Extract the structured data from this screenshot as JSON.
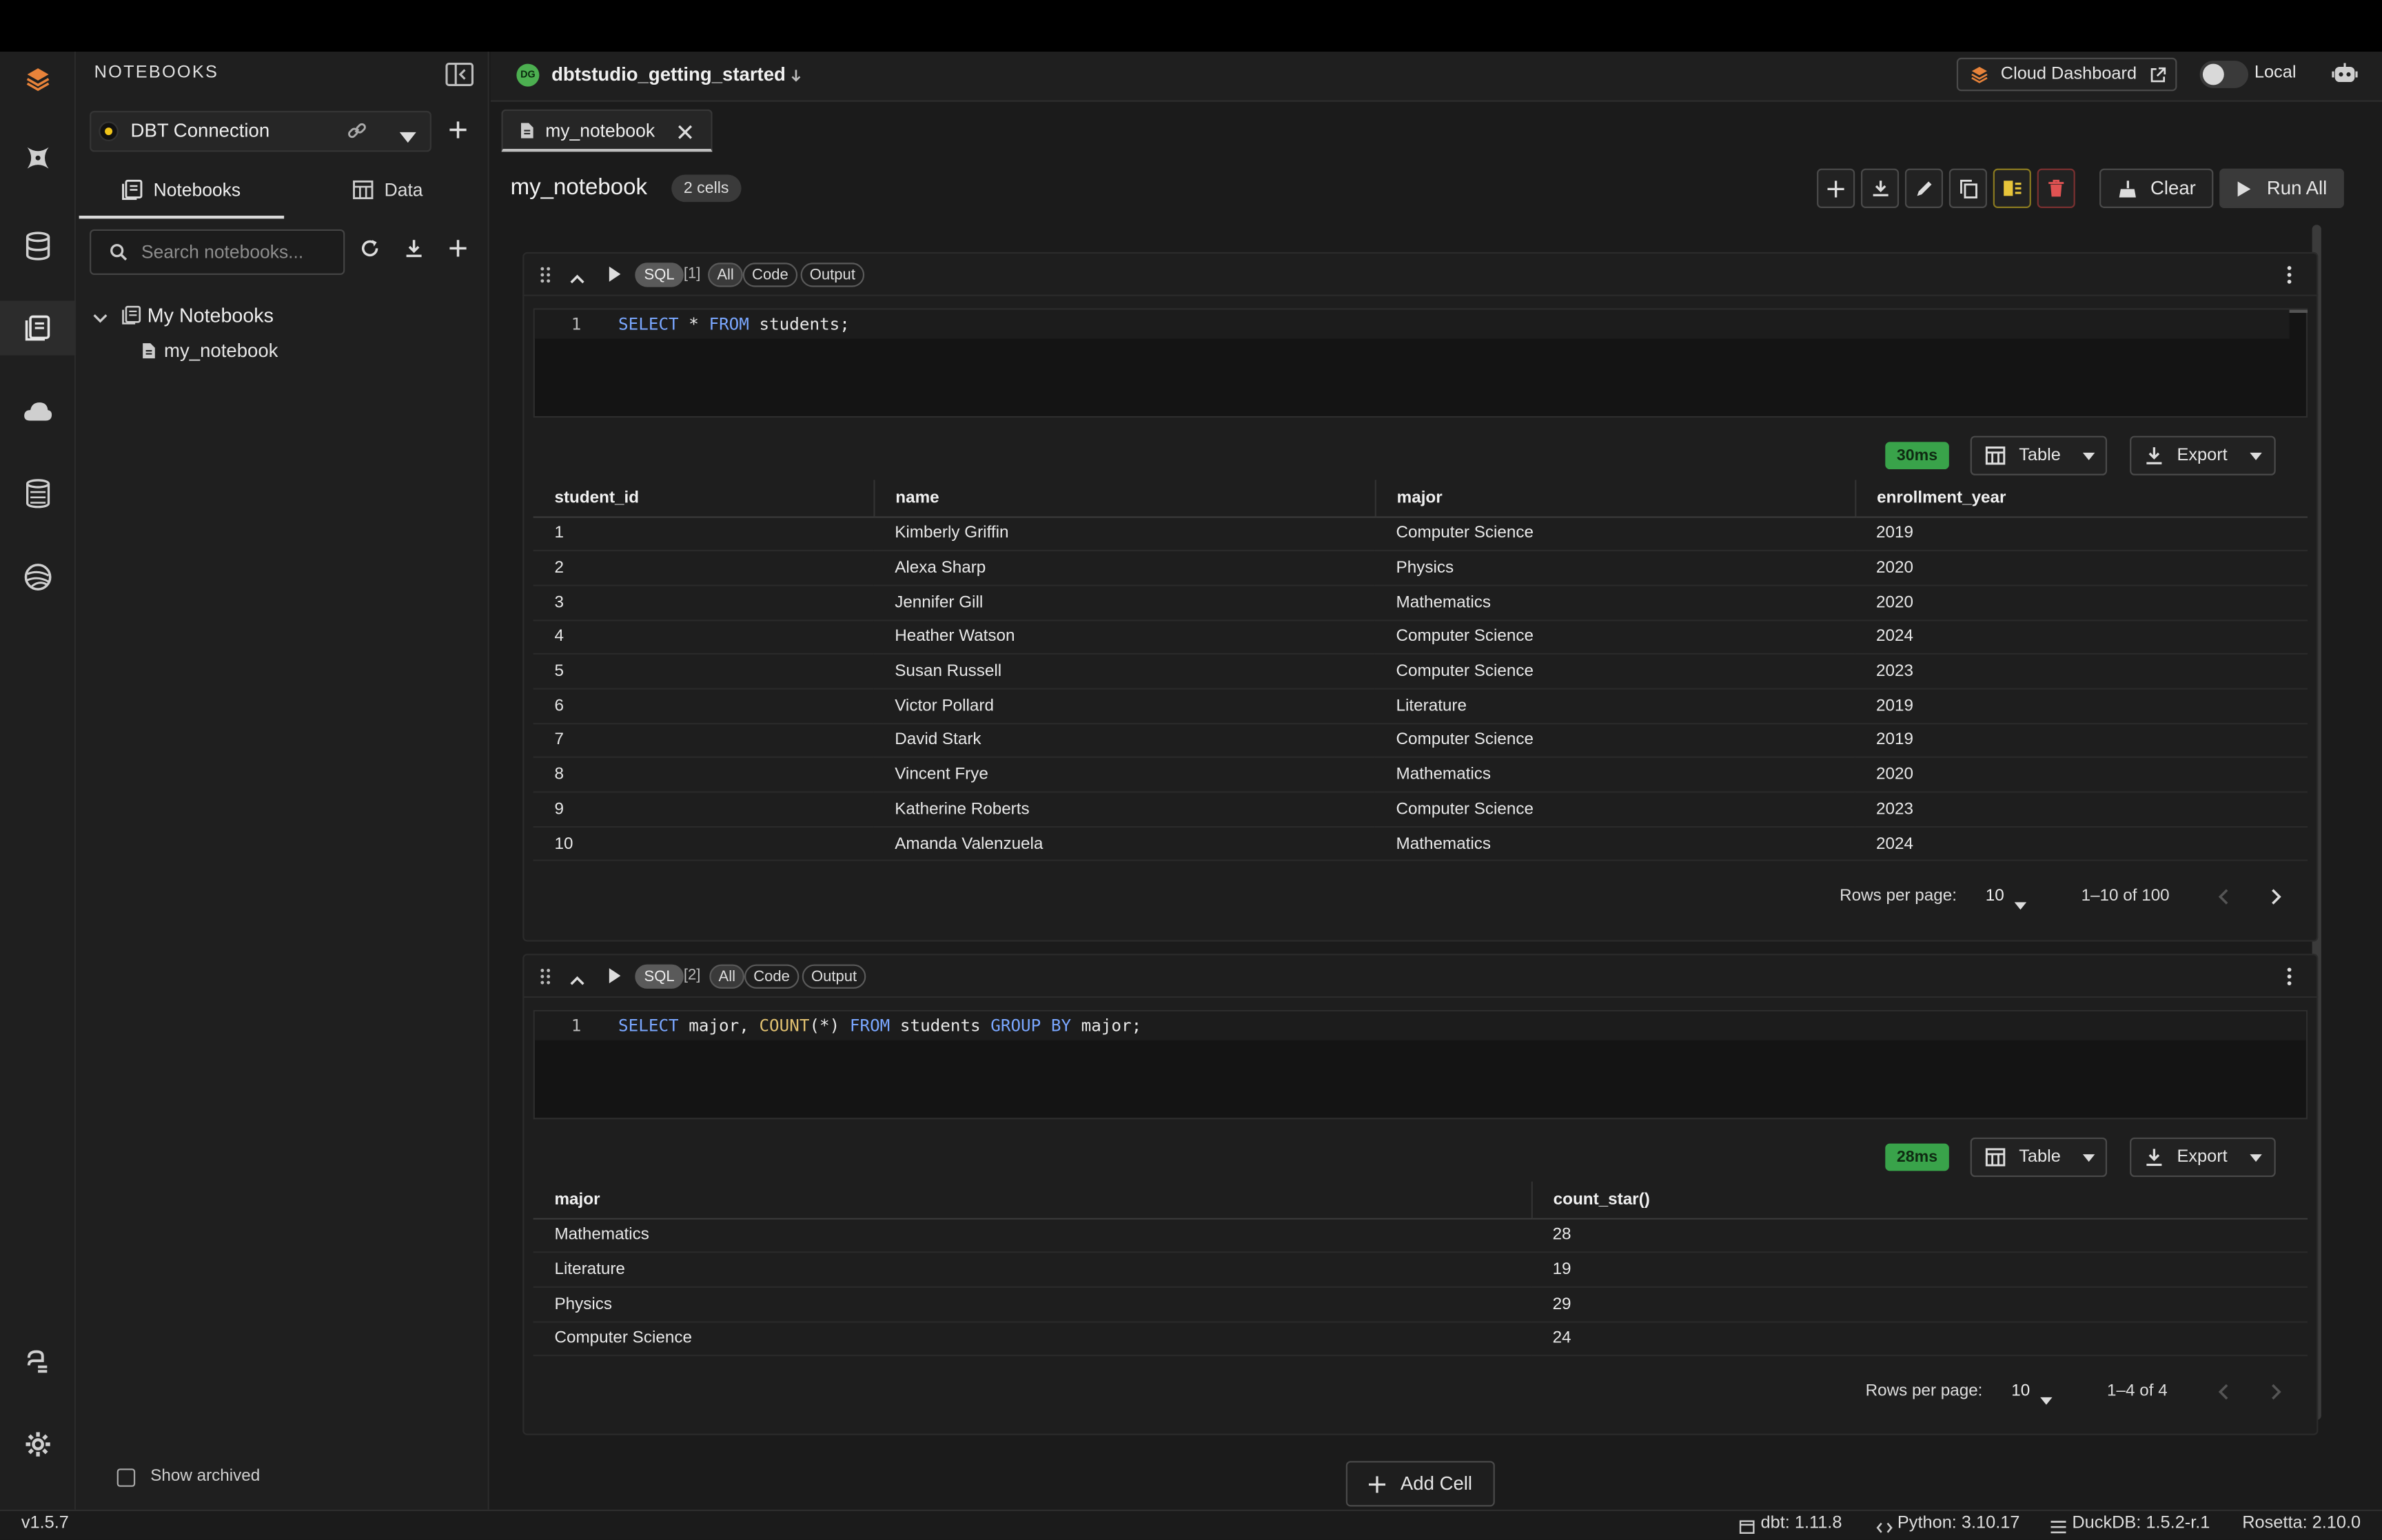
{
  "sidebar": {
    "title": "NOTEBOOKS",
    "connection": "DBT Connection",
    "tabs": [
      "Notebooks",
      "Data"
    ],
    "search_placeholder": "Search notebooks...",
    "tree_root": "My Notebooks",
    "tree_item": "my_notebook",
    "show_archived": "Show archived"
  },
  "header": {
    "project_initials": "DG",
    "project": "dbtstudio_getting_started",
    "cloud_dashboard": "Cloud Dashboard",
    "mode": "Local"
  },
  "tab": {
    "label": "my_notebook"
  },
  "notebook": {
    "title": "my_notebook",
    "cell_count": "2 cells",
    "clear_label": "Clear",
    "run_all_label": "Run All",
    "add_cell_label": "Add Cell"
  },
  "cells": [
    {
      "lang": "SQL",
      "index": "[1]",
      "chips": [
        "All",
        "Code",
        "Output"
      ],
      "line_no": "1",
      "timing": "30ms",
      "view_label": "Table",
      "export_label": "Export",
      "columns": [
        "student_id",
        "name",
        "major",
        "enrollment_year"
      ],
      "rows": [
        [
          "1",
          "Kimberly Griffin",
          "Computer Science",
          "2019"
        ],
        [
          "2",
          "Alexa Sharp",
          "Physics",
          "2020"
        ],
        [
          "3",
          "Jennifer Gill",
          "Mathematics",
          "2020"
        ],
        [
          "4",
          "Heather Watson",
          "Computer Science",
          "2024"
        ],
        [
          "5",
          "Susan Russell",
          "Computer Science",
          "2023"
        ],
        [
          "6",
          "Victor Pollard",
          "Literature",
          "2019"
        ],
        [
          "7",
          "David Stark",
          "Computer Science",
          "2019"
        ],
        [
          "8",
          "Vincent Frye",
          "Mathematics",
          "2020"
        ],
        [
          "9",
          "Katherine Roberts",
          "Computer Science",
          "2023"
        ],
        [
          "10",
          "Amanda Valenzuela",
          "Mathematics",
          "2024"
        ]
      ],
      "rows_per_page_label": "Rows per page:",
      "rows_per_page": "10",
      "range": "1–10 of 100"
    },
    {
      "lang": "SQL",
      "index": "[2]",
      "chips": [
        "All",
        "Code",
        "Output"
      ],
      "line_no": "1",
      "timing": "28ms",
      "view_label": "Table",
      "export_label": "Export",
      "columns": [
        "major",
        "count_star()"
      ],
      "rows": [
        [
          "Mathematics",
          "28"
        ],
        [
          "Literature",
          "19"
        ],
        [
          "Physics",
          "29"
        ],
        [
          "Computer Science",
          "24"
        ]
      ],
      "rows_per_page_label": "Rows per page:",
      "rows_per_page": "10",
      "range": "1–4 of 4"
    }
  ],
  "status": {
    "version": "v1.5.7",
    "dbt": "dbt: 1.11.8",
    "python": "Python: 3.10.17",
    "duckdb": "DuckDB: 1.5.2-r.1",
    "rosetta": "Rosetta: 2.10.0"
  },
  "colors": {
    "accent_orange": "#e8833a",
    "timing_green": "#39a34a",
    "project_green": "#4caf50",
    "delete_red": "#e05252",
    "warn_yellow": "#e8c53a"
  }
}
